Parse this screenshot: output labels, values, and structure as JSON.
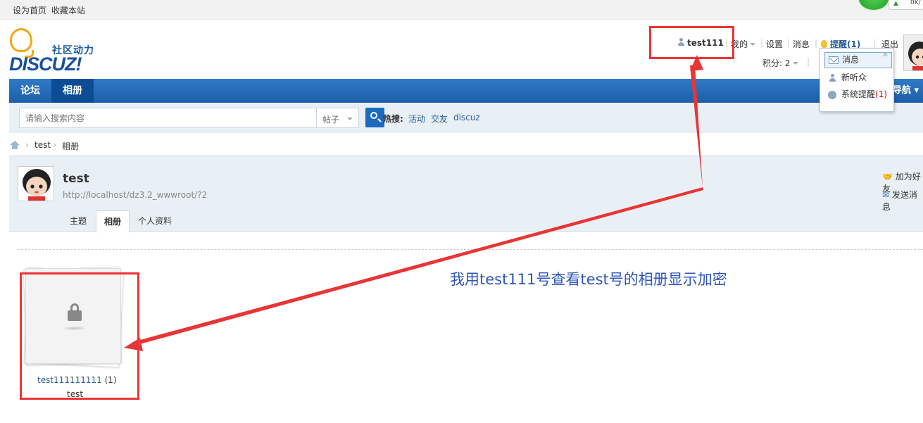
{
  "topbar": {
    "set_home": "设为首页",
    "bookmark": "收藏本站",
    "badge": "0K/"
  },
  "logo": {
    "sub": "社区动力",
    "main": "DISCUZ!"
  },
  "usermenu": {
    "username": "test111",
    "mine": "我的",
    "settings": "设置",
    "messages": "消息",
    "reminders": "提醒(1)",
    "logout": "退出",
    "points": "积分: 2",
    "sep": "|"
  },
  "dropdown": {
    "items": [
      {
        "label": "消息",
        "count": ""
      },
      {
        "label": "新听众",
        "count": ""
      },
      {
        "label": "系统提醒",
        "count": "(1)"
      }
    ],
    "close": "✕"
  },
  "nav": {
    "items": [
      "论坛",
      "相册"
    ],
    "right": "导航"
  },
  "search": {
    "placeholder": "请输入搜索内容",
    "type": "帖子",
    "hot_label": "热搜:",
    "hot": [
      "活动",
      "交友",
      "discuz"
    ]
  },
  "breadcrumb": {
    "items": [
      "test",
      "相册"
    ],
    "sep": "›"
  },
  "profile": {
    "name": "test",
    "url": "http://localhost/dz3.2_wwwroot/?2",
    "tabs": [
      "主题",
      "相册",
      "个人资料"
    ],
    "add_friend": "加为好友",
    "send_message": "发送消息"
  },
  "album": {
    "title": "test111111111",
    "count": "(1)",
    "owner": "test"
  },
  "annotation": {
    "text": "我用test111号查看test号的相册显示加密"
  },
  "colors": {
    "nav": "#1d5ea8",
    "annotation_box": "#ee3333",
    "annotation_text": "#2e55bb"
  }
}
